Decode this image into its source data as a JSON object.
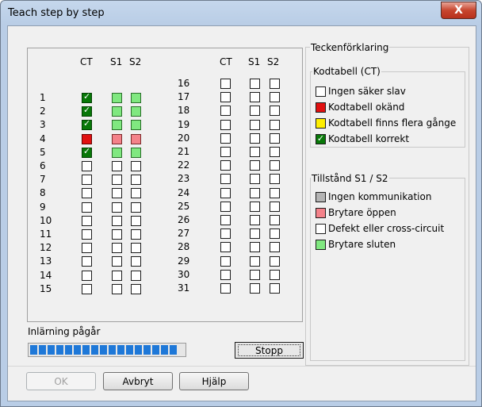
{
  "window": {
    "title": "Teach step by step",
    "close_label": "X"
  },
  "grid": {
    "headers": {
      "ct": "CT",
      "s1": "S1",
      "s2": "S2"
    },
    "left_rows": [
      {
        "label": "1",
        "ct": "correct",
        "s1": "closed",
        "s2": "closed"
      },
      {
        "label": "2",
        "ct": "correct",
        "s1": "closed",
        "s2": "closed"
      },
      {
        "label": "3",
        "ct": "correct",
        "s1": "closed",
        "s2": "closed"
      },
      {
        "label": "4",
        "ct": "unknown",
        "s1": "open",
        "s2": "open"
      },
      {
        "label": "5",
        "ct": "correct",
        "s1": "closed",
        "s2": "closed"
      },
      {
        "label": "6",
        "ct": "none",
        "s1": "none",
        "s2": "none"
      },
      {
        "label": "7",
        "ct": "none",
        "s1": "none",
        "s2": "none"
      },
      {
        "label": "8",
        "ct": "none",
        "s1": "none",
        "s2": "none"
      },
      {
        "label": "9",
        "ct": "none",
        "s1": "none",
        "s2": "none"
      },
      {
        "label": "10",
        "ct": "none",
        "s1": "none",
        "s2": "none"
      },
      {
        "label": "11",
        "ct": "none",
        "s1": "none",
        "s2": "none"
      },
      {
        "label": "12",
        "ct": "none",
        "s1": "none",
        "s2": "none"
      },
      {
        "label": "13",
        "ct": "none",
        "s1": "none",
        "s2": "none"
      },
      {
        "label": "14",
        "ct": "none",
        "s1": "none",
        "s2": "none"
      },
      {
        "label": "15",
        "ct": "none",
        "s1": "none",
        "s2": "none"
      }
    ],
    "right_rows": [
      {
        "label": "16",
        "ct": "none",
        "s1": "none",
        "s2": "none"
      },
      {
        "label": "17",
        "ct": "none",
        "s1": "none",
        "s2": "none"
      },
      {
        "label": "18",
        "ct": "none",
        "s1": "none",
        "s2": "none"
      },
      {
        "label": "19",
        "ct": "none",
        "s1": "none",
        "s2": "none"
      },
      {
        "label": "20",
        "ct": "none",
        "s1": "none",
        "s2": "none"
      },
      {
        "label": "21",
        "ct": "none",
        "s1": "none",
        "s2": "none"
      },
      {
        "label": "22",
        "ct": "none",
        "s1": "none",
        "s2": "none"
      },
      {
        "label": "23",
        "ct": "none",
        "s1": "none",
        "s2": "none"
      },
      {
        "label": "24",
        "ct": "none",
        "s1": "none",
        "s2": "none"
      },
      {
        "label": "25",
        "ct": "none",
        "s1": "none",
        "s2": "none"
      },
      {
        "label": "26",
        "ct": "none",
        "s1": "none",
        "s2": "none"
      },
      {
        "label": "27",
        "ct": "none",
        "s1": "none",
        "s2": "none"
      },
      {
        "label": "28",
        "ct": "none",
        "s1": "none",
        "s2": "none"
      },
      {
        "label": "29",
        "ct": "none",
        "s1": "none",
        "s2": "none"
      },
      {
        "label": "30",
        "ct": "none",
        "s1": "none",
        "s2": "none"
      },
      {
        "label": "31",
        "ct": "none",
        "s1": "none",
        "s2": "none"
      }
    ]
  },
  "legend": {
    "title": "Teckenförklaring",
    "ct_group": {
      "title": "Kodtabell (CT)",
      "items": [
        {
          "label": "Ingen säker slav",
          "color": "#ffffff"
        },
        {
          "label": "Kodtabell okänd",
          "color": "#e01010"
        },
        {
          "label": "Kodtabell finns flera gånge",
          "color": "#ffee00"
        },
        {
          "label": "Kodtabell korrekt",
          "color": "#087808",
          "check": true
        }
      ]
    },
    "state_group": {
      "title": "Tillstånd S1 / S2",
      "items": [
        {
          "label": "Ingen kommunikation",
          "color": "#b4b4b4"
        },
        {
          "label": "Brytare öppen",
          "color": "#f4828a"
        },
        {
          "label": "Defekt eller cross-circuit",
          "color": "#ffffff"
        },
        {
          "label": "Brytare sluten",
          "color": "#80e880"
        }
      ]
    }
  },
  "progress": {
    "label": "Inlärning pågår",
    "fraction": 0.98,
    "color": "#1e78d8"
  },
  "buttons": {
    "stop": "Stopp",
    "ok": "OK",
    "cancel": "Avbryt",
    "help": "Hjälp"
  }
}
